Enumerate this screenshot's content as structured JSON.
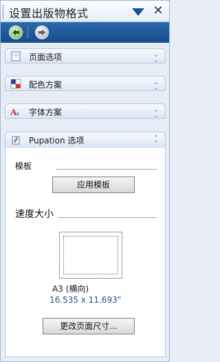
{
  "pane": {
    "title": "设置出版物格式",
    "dropdown_icon": "triangle-down-icon",
    "close_icon": "close-icon"
  },
  "nav": {
    "back_icon": "back-arrow-icon",
    "forward_icon": "forward-arrow-icon"
  },
  "sections": [
    {
      "label": "页面选项",
      "icon": "page-options-icon",
      "expanded": false
    },
    {
      "label": "配色方案",
      "icon": "color-scheme-icon",
      "expanded": false
    },
    {
      "label": "字体方案",
      "icon": "font-scheme-icon",
      "expanded": false
    },
    {
      "label": "Pupation 选项",
      "icon": "pupation-options-icon",
      "expanded": true
    }
  ],
  "pupation": {
    "template_label": "模板",
    "apply_template_button": "应用模板",
    "speed_size_label": "速度大小",
    "page_size_name": "A3 (横向)",
    "page_size_dims": "16.535 x 11.693\"",
    "change_page_size_button": "更改页面尺寸..."
  },
  "colors": {
    "accent_blue": "#1b4f8e",
    "chevron": "#6a8bb8",
    "back_green": "#8cc86a"
  }
}
